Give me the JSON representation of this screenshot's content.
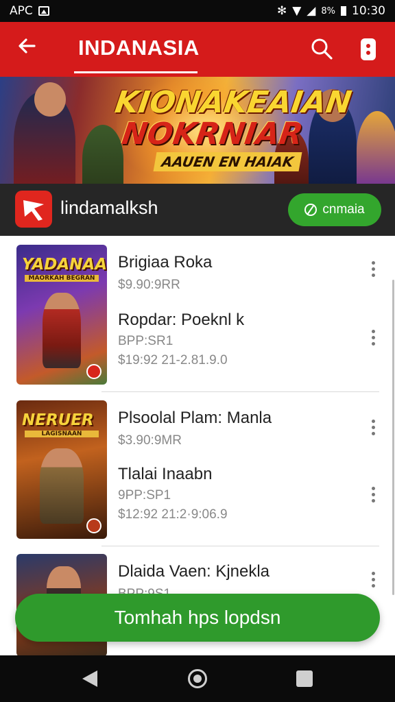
{
  "status_bar": {
    "left_label": "APC",
    "time": "10:30",
    "battery": "8%"
  },
  "app_bar": {
    "title": "INDANASIA"
  },
  "banner": {
    "title_line1": "KIONAKEAIAN",
    "title_line2": "NOKRNIAR",
    "subtitle": "AAUEN EN HAIAK"
  },
  "channel": {
    "name": "lindamalksh",
    "subscribe_label": "cnmaia"
  },
  "cards": [
    {
      "thumb_title": "YADANAA",
      "thumb_subtitle": "MAORKAH BEGRAN",
      "items": [
        {
          "title": "Brigiaa Roka",
          "line1": "$9.90:9RR",
          "line2": ""
        },
        {
          "title": "Ropdar: Poeknl k",
          "line1": "BPP:SR1",
          "line2": "$19:92 21-2.81.9.0"
        }
      ]
    },
    {
      "thumb_title": "NERUER",
      "thumb_subtitle": "LAGISNAAN",
      "items": [
        {
          "title": "Plsoolal Plam: Manla",
          "line1": "$3.90:9MR",
          "line2": ""
        },
        {
          "title": "Tlalai Inaabn",
          "line1": "9PP:SP1",
          "line2": "$12:92 21:2·9:06.9"
        }
      ]
    },
    {
      "thumb_title": "",
      "thumb_subtitle": "",
      "items": [
        {
          "title": "Dlaida Vaen: Kjnekla",
          "line1": "BPP:9S1",
          "line2": ""
        }
      ]
    }
  ],
  "cta": {
    "label": "Tomhah hps lopdsn"
  },
  "colors": {
    "primary_red": "#d51b1b",
    "green": "#2f9a2c",
    "channel_bg": "#262626"
  }
}
